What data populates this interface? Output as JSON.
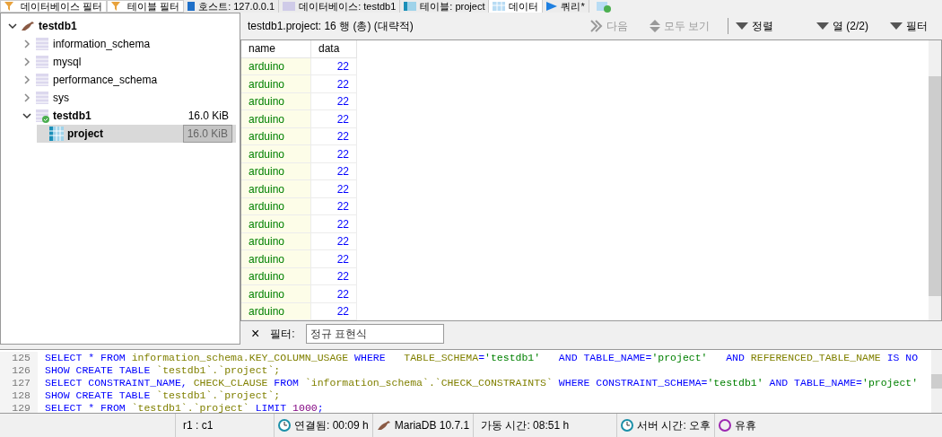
{
  "top_tabs": [
    {
      "label": "데이터베이스 필터",
      "kind": "filter",
      "selected": false
    },
    {
      "label": "테이블 필터",
      "kind": "filter",
      "selected": false
    },
    {
      "label": "호스트: 127.0.0.1",
      "kind": "host",
      "selected": false
    },
    {
      "label": "데이터베이스: testdb1",
      "kind": "database",
      "selected": false
    },
    {
      "label": "테이블: project",
      "kind": "table",
      "selected": false
    },
    {
      "label": "데이터",
      "kind": "data",
      "selected": true
    },
    {
      "label": "쿼리*",
      "kind": "query",
      "selected": false
    }
  ],
  "tree": {
    "label": "testdb1",
    "expanded": true,
    "children": [
      {
        "label": "information_schema",
        "expanded": false,
        "bold": false
      },
      {
        "label": "mysql",
        "expanded": false,
        "bold": false
      },
      {
        "label": "performance_schema",
        "expanded": false,
        "bold": false
      },
      {
        "label": "sys",
        "expanded": false,
        "bold": false
      },
      {
        "label": "testdb1",
        "expanded": true,
        "bold": true,
        "size": "16.0 KiB",
        "children": [
          {
            "label": "project",
            "selected": true,
            "size": "16.0 KiB"
          }
        ]
      }
    ]
  },
  "data_info": "testdb1.project: 16 행 (총) (대략적)",
  "toolbar": [
    {
      "label": "다음",
      "kind": "next",
      "disabled": true
    },
    {
      "label": "모두 보기",
      "kind": "showall",
      "disabled": true
    },
    {
      "label": "정렬",
      "kind": "dropdown",
      "disabled": false
    },
    {
      "label": "열 (2/2)",
      "kind": "dropdown",
      "disabled": false
    },
    {
      "label": "필터",
      "kind": "dropdown",
      "disabled": false
    }
  ],
  "table": {
    "columns": [
      "name",
      "data"
    ],
    "rows": [
      [
        "arduino",
        "22"
      ],
      [
        "arduino",
        "22"
      ],
      [
        "arduino",
        "22"
      ],
      [
        "arduino",
        "22"
      ],
      [
        "arduino",
        "22"
      ],
      [
        "arduino",
        "22"
      ],
      [
        "arduino",
        "22"
      ],
      [
        "arduino",
        "22"
      ],
      [
        "arduino",
        "22"
      ],
      [
        "arduino",
        "22"
      ],
      [
        "arduino",
        "22"
      ],
      [
        "arduino",
        "22"
      ],
      [
        "arduino",
        "22"
      ],
      [
        "arduino",
        "22"
      ],
      [
        "arduino",
        "22"
      ]
    ]
  },
  "filter": {
    "close": "×",
    "label": "필터:",
    "placeholder": "정규 표현식"
  },
  "sql": [
    {
      "number": "125",
      "tokens": [
        {
          "kind": "keyword",
          "text": "SELECT * FROM "
        },
        {
          "kind": "ident",
          "text": "information_schema.KEY_COLUMN_USAGE "
        },
        {
          "kind": "keyword",
          "text": "WHERE   "
        },
        {
          "kind": "ident",
          "text": "TABLE_SCHEMA"
        },
        {
          "kind": "keyword",
          "text": "="
        },
        {
          "kind": "string",
          "text": "'testdb1'"
        },
        {
          "kind": "keyword",
          "text": "   AND TABLE_NAME="
        },
        {
          "kind": "string",
          "text": "'project'"
        },
        {
          "kind": "keyword",
          "text": "   AND "
        },
        {
          "kind": "ident",
          "text": "REFERENCED_TABLE_NAME "
        },
        {
          "kind": "keyword",
          "text": "IS NO"
        }
      ]
    },
    {
      "number": "126",
      "tokens": [
        {
          "kind": "keyword",
          "text": "SHOW CREATE TABLE "
        },
        {
          "kind": "ident",
          "text": "`testdb1`.`project`;"
        }
      ]
    },
    {
      "number": "127",
      "tokens": [
        {
          "kind": "keyword",
          "text": "SELECT CONSTRAINT_NAME, "
        },
        {
          "kind": "ident",
          "text": "CHECK_CLAUSE "
        },
        {
          "kind": "keyword",
          "text": "FROM "
        },
        {
          "kind": "ident",
          "text": "`information_schema`.`CHECK_CONSTRAINTS` "
        },
        {
          "kind": "keyword",
          "text": "WHERE CONSTRAINT_SCHEMA="
        },
        {
          "kind": "string",
          "text": "'testdb1'"
        },
        {
          "kind": "keyword",
          "text": " AND TABLE_NAME="
        },
        {
          "kind": "string",
          "text": "'project'"
        }
      ]
    },
    {
      "number": "128",
      "tokens": [
        {
          "kind": "keyword",
          "text": "SHOW CREATE TABLE "
        },
        {
          "kind": "ident",
          "text": "`testdb1`.`project`;"
        }
      ]
    },
    {
      "number": "129",
      "tokens": [
        {
          "kind": "keyword",
          "text": "SELECT * FROM "
        },
        {
          "kind": "ident",
          "text": "`testdb1`.`project` "
        },
        {
          "kind": "keyword",
          "text": "LIMIT "
        },
        {
          "kind": "number",
          "text": "1000"
        },
        {
          "kind": "keyword",
          "text": ";"
        }
      ]
    }
  ],
  "status_bar": [
    {
      "text": "r1 : c1",
      "kind": "plain"
    },
    {
      "text": "연결됨: 00:09 h",
      "kind": "clock"
    },
    {
      "text": "MariaDB 10.7.1",
      "kind": "seal"
    },
    {
      "text": "가동 시간: 08:51 h",
      "kind": "plain"
    },
    {
      "text": "서버 시간: 오후",
      "kind": "clock"
    },
    {
      "text": "유휴",
      "kind": "idle"
    }
  ]
}
